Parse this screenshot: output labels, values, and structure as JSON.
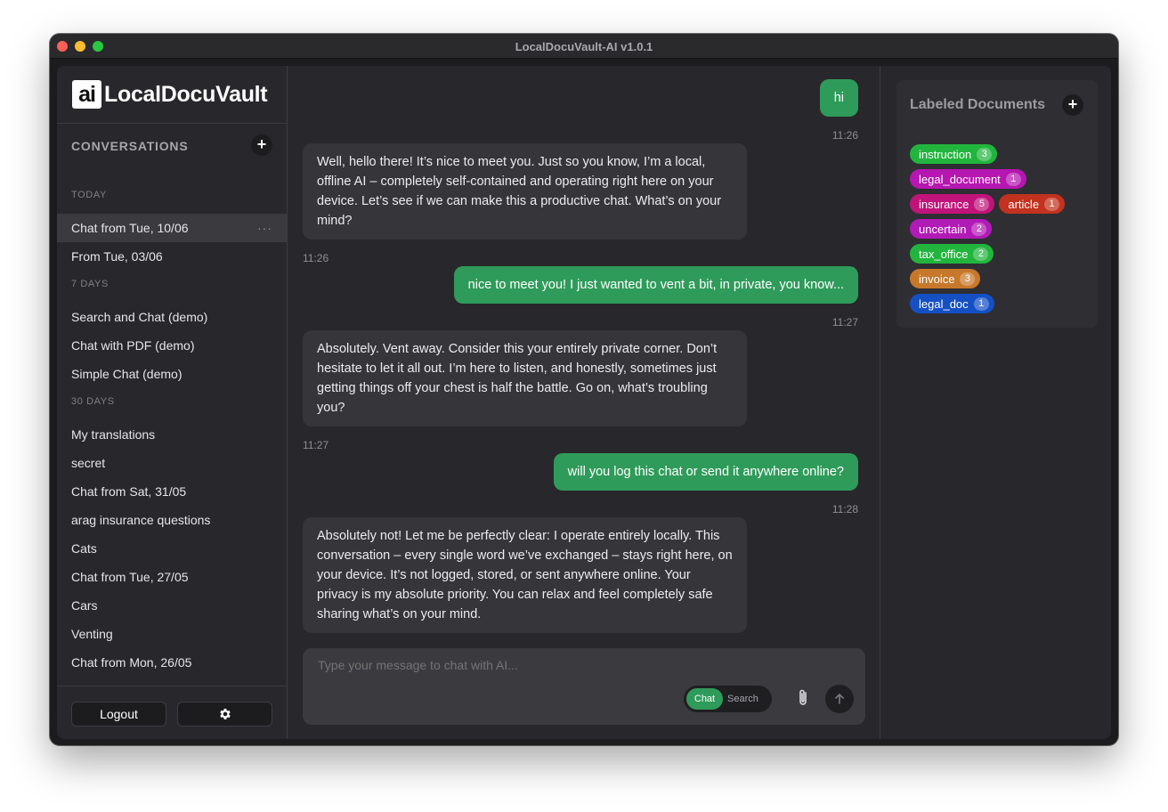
{
  "window": {
    "title": "LocalDocuVault-AI v1.0.1"
  },
  "sidebar": {
    "logo_badge": "ai",
    "logo_text": "LocalDocuVault",
    "heading": "CONVERSATIONS",
    "add_label": "+",
    "groups": [
      {
        "label": "TODAY",
        "items": [
          "Chat from Tue, 10/06",
          "From Tue, 03/06"
        ]
      },
      {
        "label": "7 DAYS",
        "items": [
          "Search and Chat (demo)",
          "Chat with PDF (demo)",
          "Simple Chat (demo)"
        ]
      },
      {
        "label": "30 DAYS",
        "items": [
          "My translations",
          "secret",
          "Chat from Sat, 31/05",
          "arag insurance questions",
          "Cats",
          "Chat from Tue, 27/05",
          "Cars",
          "Venting",
          "Chat from Mon, 26/05"
        ]
      }
    ],
    "active_more": "···",
    "logout_label": "Logout"
  },
  "chat": {
    "messages": [
      {
        "role": "user",
        "text": "hi",
        "time": "11:26"
      },
      {
        "role": "ai",
        "text": "Well, hello there! It’s nice to meet you. Just so you know, I’m a local, offline AI – completely self-contained and operating right here on your device. Let’s see if we can make this a productive chat. What’s on your mind?",
        "time": "11:26"
      },
      {
        "role": "user",
        "text": "nice to meet you! I just wanted to vent a bit, in private, you know...",
        "time": "11:27"
      },
      {
        "role": "ai",
        "text": "Absolutely. Vent away. Consider this your entirely private corner. Don’t hesitate to let it all out. I’m here to listen, and honestly, sometimes just getting things off your chest is half the battle. Go on, what’s troubling you?",
        "time": "11:27"
      },
      {
        "role": "user",
        "text": "will you log this chat or send it anywhere online?",
        "time": "11:28"
      },
      {
        "role": "ai",
        "text": "Absolutely not! Let me be perfectly clear: I operate entirely locally. This conversation – every single word we’ve exchanged – stays right here, on your device. It’s not logged, stored, or sent anywhere online. Your privacy is my absolute priority. You can relax and feel completely safe sharing what’s on your mind."
      }
    ],
    "composer": {
      "placeholder": "Type your message to chat with AI...",
      "mode_chat": "Chat",
      "mode_search": "Search"
    }
  },
  "labels": {
    "heading": "Labeled Documents",
    "add_label": "+",
    "rows": [
      [
        {
          "name": "instruction",
          "count": "3",
          "color": "#22b53d"
        }
      ],
      [
        {
          "name": "legal_document",
          "count": "1",
          "color": "#b517b0"
        }
      ],
      [
        {
          "name": "insurance",
          "count": "5",
          "color": "#c0147a"
        },
        {
          "name": "article",
          "count": "1",
          "color": "#c2321f"
        }
      ],
      [
        {
          "name": "uncertain",
          "count": "2",
          "color": "#b21ab6"
        }
      ],
      [
        {
          "name": "tax_office",
          "count": "2",
          "color": "#22b53d"
        }
      ],
      [
        {
          "name": "invoice",
          "count": "3",
          "color": "#c7782a"
        }
      ],
      [
        {
          "name": "legal_doc",
          "count": "1",
          "color": "#1450c4"
        }
      ]
    ]
  },
  "colors": {
    "accent": "#2f9b5a",
    "user_bubble": "#2f9b5a",
    "ai_bubble": "#35353a",
    "background": "#28282c"
  }
}
